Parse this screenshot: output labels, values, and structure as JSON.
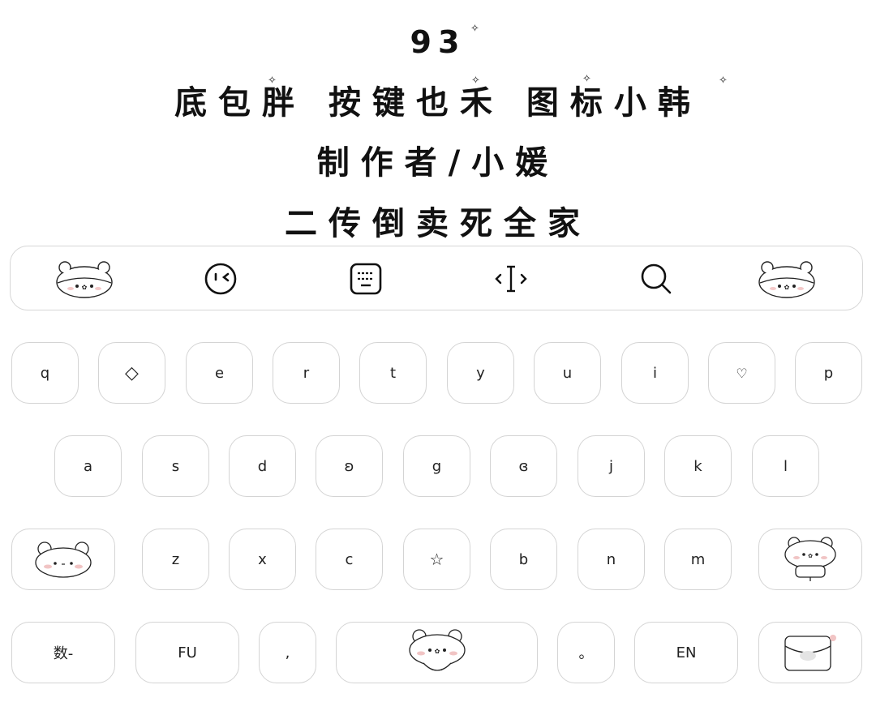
{
  "header": {
    "line1": "93",
    "line2": "底包胖 按键也禾 图标小韩",
    "line3": "制作者/小媛",
    "line4": "二传倒卖死全家"
  },
  "toolbar": {
    "items": [
      {
        "icon": "bear-face-icon"
      },
      {
        "icon": "wink-emoji-icon"
      },
      {
        "icon": "keyboard-icon"
      },
      {
        "icon": "cursor-move-icon"
      },
      {
        "icon": "search-icon"
      },
      {
        "icon": "bear-face-icon"
      }
    ]
  },
  "keyboard": {
    "row1": [
      "q",
      "◇",
      "e",
      "r",
      "t",
      "y",
      "u",
      "i",
      "♡",
      "p"
    ],
    "row2": [
      "a",
      "s",
      "d",
      "ʚ",
      "g",
      "ɞ",
      "j",
      "k",
      "l"
    ],
    "row3": [
      "bear-shift-icon",
      "z",
      "x",
      "c",
      "☆",
      "b",
      "n",
      "m",
      "bear-backspace-icon"
    ],
    "row4": {
      "num": "数-",
      "fu": "FU",
      "comma": ",",
      "space": "bear-space-icon",
      "period": "。",
      "en": "EN",
      "enter": "bag-enter-icon"
    }
  }
}
